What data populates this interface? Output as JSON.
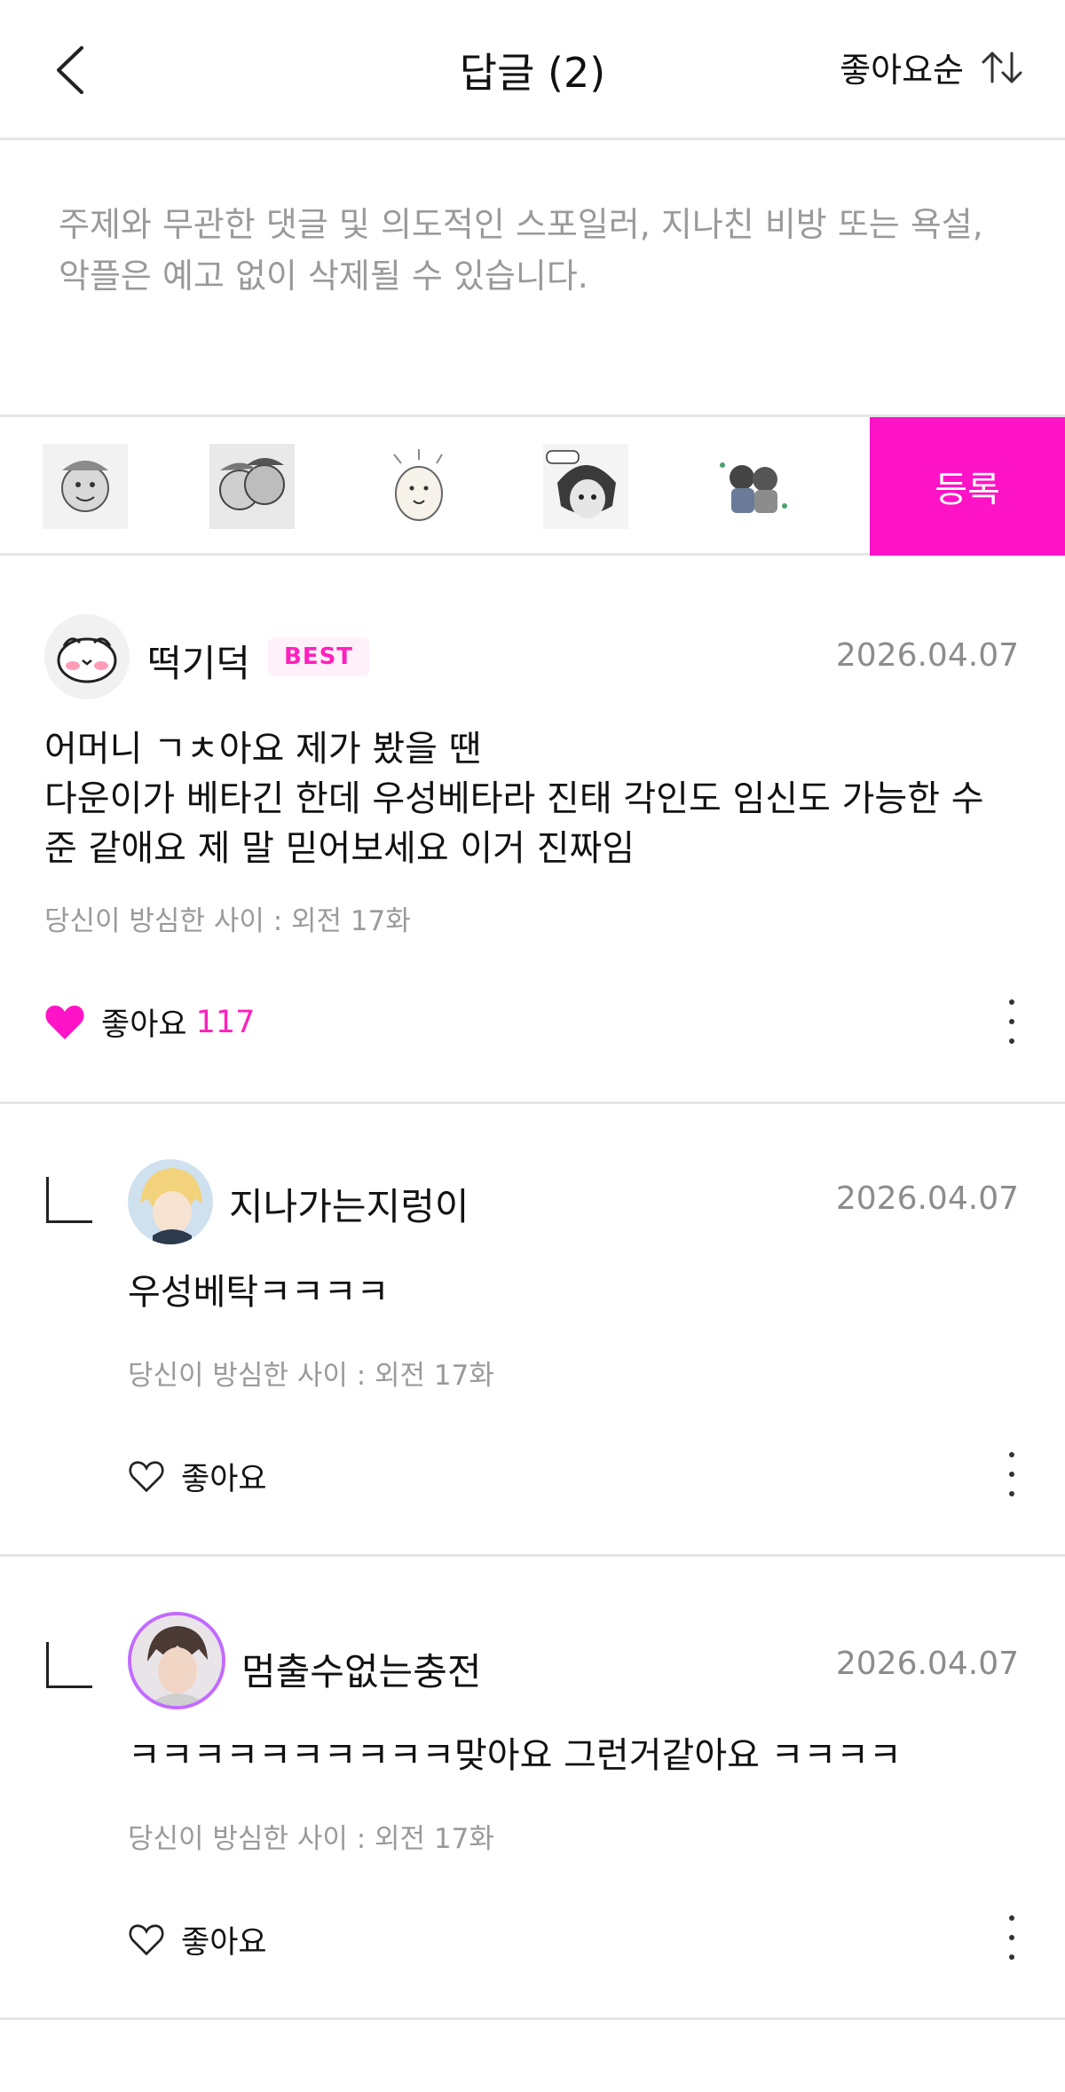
{
  "header": {
    "title": "답글 (2)",
    "sort_label": "좋아요순"
  },
  "composer": {
    "placeholder": "주제와 무관한 댓글 및 의도적인 스포일러, 지나친 비방 또는 욕설, 악플은 예고 없이 삭제될 수 있습니다."
  },
  "stickers": {
    "submit_label": "등록"
  },
  "comments": [
    {
      "author": "떡기덕",
      "badge": "BEST",
      "date": "2026.04.07",
      "text_lines": [
        "어머니 ㄱㅊ아요 제가 봤을 땐",
        "다운이가 베타긴 한데 우성베타라 진태 각인도 임신도 가능한 수",
        "준 같애요 제 말 믿어보세요 이거 진짜임"
      ],
      "episode": "당신이 방심한 사이 : 외전 17화",
      "like_label": "좋아요",
      "like_count": "117",
      "liked": true
    },
    {
      "author": "지나가는지렁이",
      "date": "2026.04.07",
      "text": "우성베탁ㅋㅋㅋㅋ",
      "episode": "당신이 방심한 사이 : 외전 17화",
      "like_label": "좋아요",
      "liked": false
    },
    {
      "author": "멈출수없는충전",
      "date": "2026.04.07",
      "text": "ㅋㅋㅋㅋㅋㅋㅋㅋㅋㅋ맞아요 그런거같아요 ㅋㅋㅋㅋ",
      "episode": "당신이 방심한 사이 : 외전 17화",
      "like_label": "좋아요",
      "liked": false
    }
  ],
  "colors": {
    "accent": "#ff13c6",
    "divider": "#e6e6e6",
    "muted_text": "#9a9a9a"
  }
}
